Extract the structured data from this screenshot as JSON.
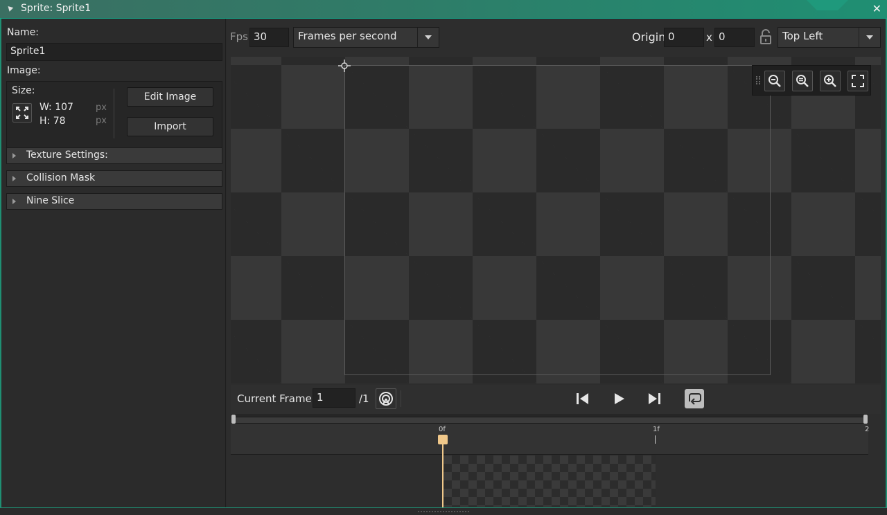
{
  "window": {
    "title": "Sprite: Sprite1"
  },
  "left": {
    "name_label": "Name:",
    "name_value": "Sprite1",
    "image_label": "Image:",
    "size_label": "Size:",
    "width_text": "W: 107",
    "height_text": "H: 78",
    "unit": "px",
    "edit_button": "Edit Image",
    "import_button": "Import",
    "sections": [
      "Texture Settings:",
      "Collision Mask",
      "Nine Slice"
    ]
  },
  "toolbar": {
    "fps_label": "Fps",
    "fps_value": "30",
    "fps_mode": "Frames per second",
    "origin_label": "Origin",
    "origin_x": "0",
    "origin_sep": "x",
    "origin_y": "0",
    "origin_preset": "Top Left"
  },
  "playback": {
    "current_frame_label": "Current Frame:",
    "current_frame_value": "1",
    "total_frames": "/1"
  },
  "timeline": {
    "ticks": [
      "0f",
      "1f",
      "2"
    ]
  },
  "colors": {
    "accent": "#1f8f73",
    "playhead": "#f0c88a"
  }
}
